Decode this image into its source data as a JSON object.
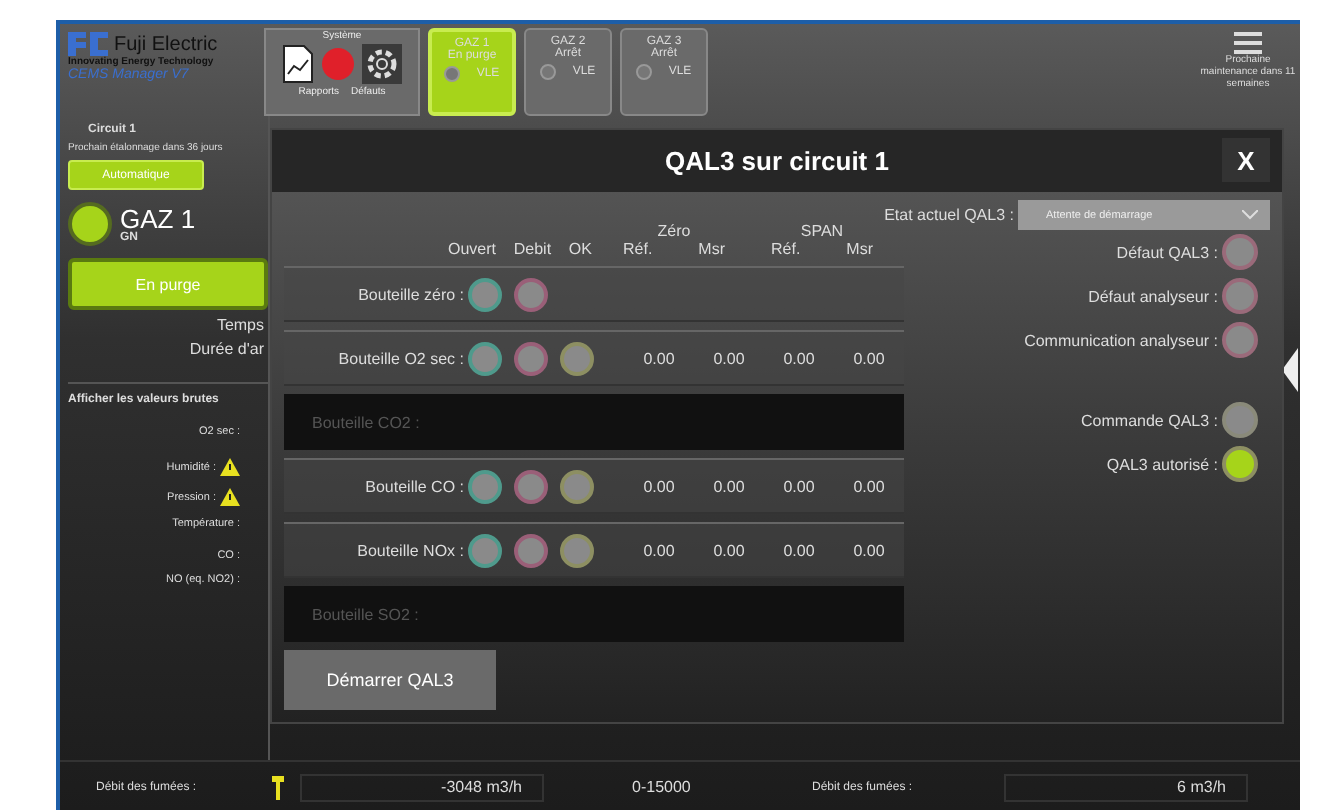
{
  "header": {
    "brand": "Fuji Electric",
    "tagline": "Innovating Energy Technology",
    "product": "CEMS Manager V7",
    "system": {
      "title": "Système",
      "items": [
        "Rapports",
        "Défauts"
      ]
    },
    "gas_tabs": [
      {
        "name": "GAZ 1",
        "status": "En purge",
        "limit": "VLE",
        "selected": true
      },
      {
        "name": "GAZ 2",
        "status": "Arrêt",
        "limit": "VLE",
        "selected": false
      },
      {
        "name": "GAZ 3",
        "status": "Arrêt",
        "limit": "VLE",
        "selected": false
      }
    ],
    "maintenance": "Prochaine maintenance dans 11 semaines"
  },
  "left_panel": {
    "circuit": "Circuit 1",
    "next_calibration": "Prochain étalonnage dans 36 jours",
    "mode": "Automatique",
    "gas": {
      "name": "GAZ 1",
      "fuel": "GN",
      "status": "En purge",
      "on": true
    },
    "time_labels": [
      "Temps",
      "Durée d'ar"
    ],
    "raw_values": "Afficher les valeurs brutes",
    "measure_groups": [
      {
        "items": [
          {
            "label": "O2 sec :",
            "warning": false
          }
        ]
      },
      {
        "items": [
          {
            "label": "Humidité :",
            "warning": true
          },
          {
            "label": "Pression :",
            "warning": true
          },
          {
            "label": "Température :",
            "warning": false
          }
        ]
      },
      {
        "items": [
          {
            "label": "CO :",
            "warning": false
          },
          {
            "label": "NO (eq. NO2) :",
            "warning": false
          }
        ]
      }
    ]
  },
  "bottom": [
    {
      "label": "Débit des fumées :",
      "value": "-3048 m3/h",
      "range": "0-15000",
      "warning": true
    },
    {
      "label": "Débit des fumées :",
      "value": "6 m3/h",
      "warning": false
    }
  ],
  "modal": {
    "title": "QAL3 sur circuit 1",
    "close": "X",
    "state_label": "Etat actuel QAL3 :",
    "state_value": "Attente de démarrage",
    "columns": {
      "indicators": [
        "Ouvert",
        "Debit",
        "OK"
      ],
      "groups": [
        {
          "name": "Zéro",
          "sub": [
            "Réf.",
            "Msr"
          ]
        },
        {
          "name": "SPAN",
          "sub": [
            "Réf.",
            "Msr"
          ]
        }
      ]
    },
    "rows": [
      {
        "label": "Bouteille zéro :",
        "enabled": true,
        "indicators": [
          {
            "kind": "ouvert",
            "on": false
          },
          {
            "kind": "debit",
            "on": false
          }
        ],
        "values": []
      },
      {
        "label": "Bouteille O2 sec :",
        "enabled": true,
        "indicators": [
          {
            "kind": "ouvert",
            "on": false
          },
          {
            "kind": "debit",
            "on": false
          },
          {
            "kind": "ok",
            "on": false
          }
        ],
        "values": [
          "0.00",
          "0.00",
          "0.00",
          "0.00"
        ]
      },
      {
        "label": "Bouteille CO2 :",
        "enabled": false,
        "indicators": [],
        "values": []
      },
      {
        "label": "Bouteille CO :",
        "enabled": true,
        "indicators": [
          {
            "kind": "ouvert",
            "on": false
          },
          {
            "kind": "debit",
            "on": false
          },
          {
            "kind": "ok",
            "on": false
          }
        ],
        "values": [
          "0.00",
          "0.00",
          "0.00",
          "0.00"
        ]
      },
      {
        "label": "Bouteille NOx :",
        "enabled": true,
        "indicators": [
          {
            "kind": "ouvert",
            "on": false
          },
          {
            "kind": "debit",
            "on": false
          },
          {
            "kind": "ok",
            "on": false
          }
        ],
        "values": [
          "0.00",
          "0.00",
          "0.00",
          "0.00"
        ]
      },
      {
        "label": "Bouteille SO2 :",
        "enabled": false,
        "indicators": [],
        "values": []
      }
    ],
    "status_groups": [
      {
        "items": [
          {
            "label": "Défaut QAL3 :",
            "kind": "fault",
            "on": false
          },
          {
            "label": "Défaut analyseur :",
            "kind": "fault",
            "on": false
          },
          {
            "label": "Communication analyseur :",
            "kind": "fault",
            "on": false
          }
        ]
      },
      {
        "items": [
          {
            "label": "Commande QAL3 :",
            "kind": "command",
            "on": false
          },
          {
            "label": "QAL3 autorisé :",
            "kind": "ok",
            "on": true
          }
        ]
      }
    ],
    "start_button": "Démarrer QAL3"
  }
}
